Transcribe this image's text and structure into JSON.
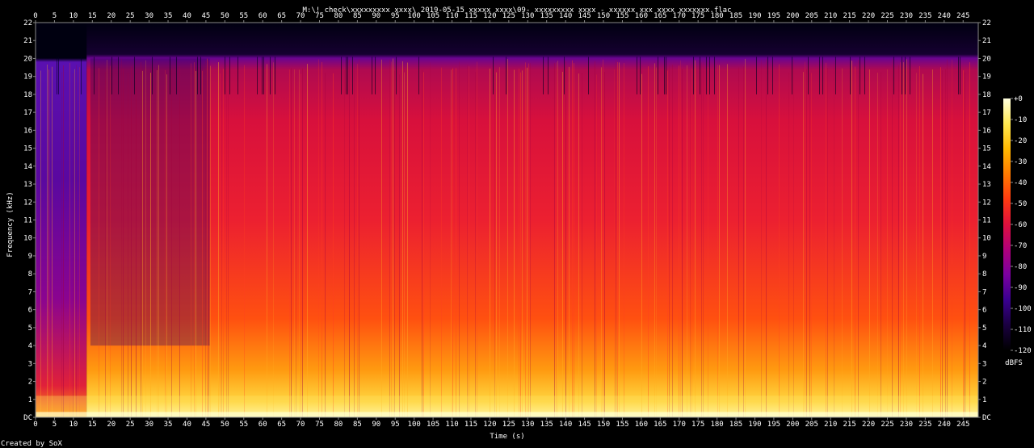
{
  "chart_data": {
    "type": "heatmap",
    "title": "M:\\! check\\xxxxxxxxx xxxx\\ 2019-05-15  xxxxx xxxx\\09- xxxxxxxxx xxxx - xxxxxx xxx xxxx xxxxxxx.flac",
    "xlabel": "Time (s)",
    "ylabel": "Frequency (kHz)",
    "xlim": [
      0,
      249
    ],
    "ylim": [
      0,
      22
    ],
    "x_ticks": [
      0,
      5,
      10,
      15,
      20,
      25,
      30,
      35,
      40,
      45,
      50,
      55,
      60,
      65,
      70,
      75,
      80,
      85,
      90,
      95,
      100,
      105,
      110,
      115,
      120,
      125,
      130,
      135,
      140,
      145,
      150,
      155,
      160,
      165,
      170,
      175,
      180,
      185,
      190,
      195,
      200,
      205,
      210,
      215,
      220,
      225,
      230,
      235,
      240,
      245
    ],
    "y_ticks": [
      "DC",
      "1",
      "2",
      "3",
      "4",
      "5",
      "6",
      "7",
      "8",
      "9",
      "10",
      "11",
      "12",
      "13",
      "14",
      "15",
      "16",
      "17",
      "18",
      "19",
      "20",
      "21",
      "22"
    ],
    "colorbar": {
      "label": "dBFS",
      "range": [
        -120,
        0
      ],
      "ticks": [
        "+0",
        "-10",
        "-20",
        "-30",
        "-40",
        "-50",
        "-60",
        "-70",
        "-80",
        "-90",
        "-100",
        "-110",
        "-120"
      ],
      "colors": [
        "#000000",
        "#1a0040",
        "#3a0090",
        "#7a00a0",
        "#b0007a",
        "#e0103c",
        "#ff3a10",
        "#ff7a00",
        "#ffb800",
        "#ffe850",
        "#ffffe0"
      ]
    },
    "spectrum_cutoff_khz": 20,
    "credit": "Created by SoX"
  }
}
